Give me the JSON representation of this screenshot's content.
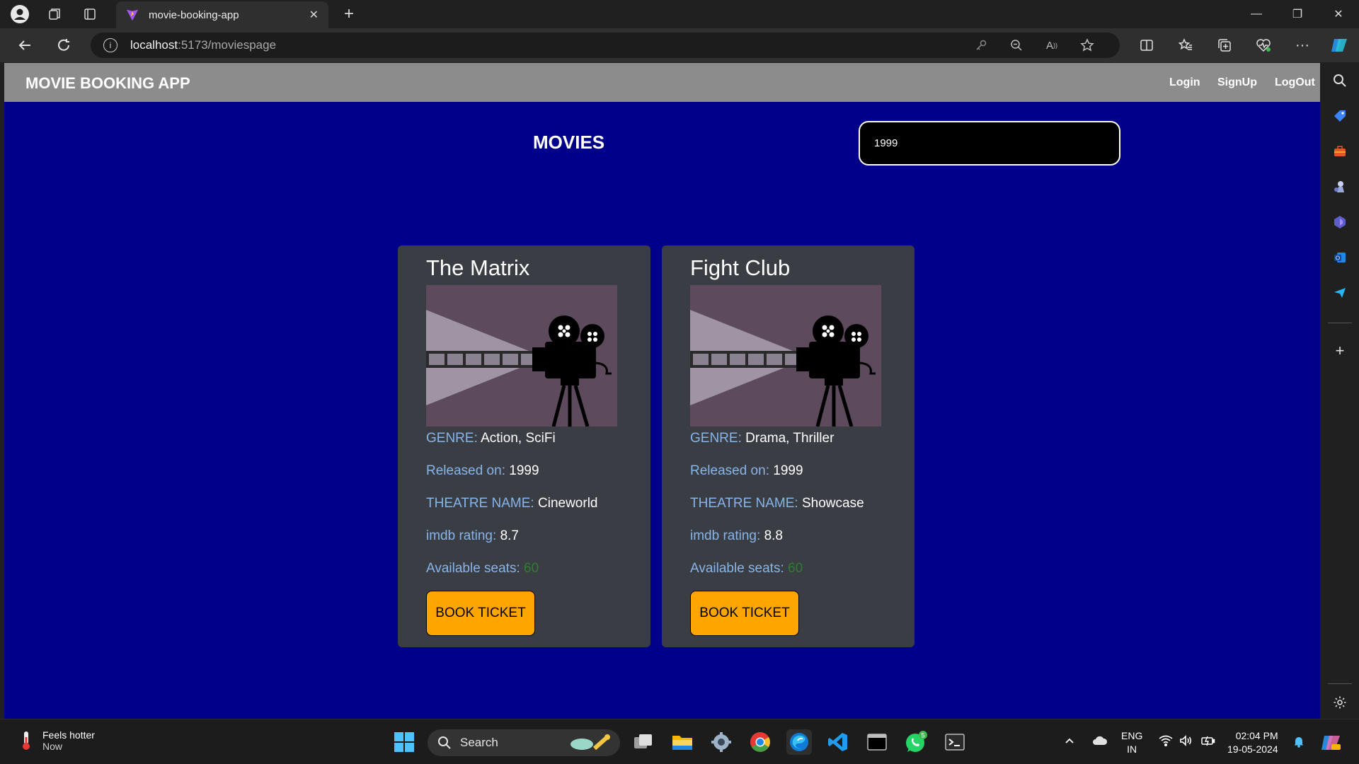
{
  "browser": {
    "tab_title": "movie-booking-app",
    "url_host": "localhost",
    "url_path": ":5173/moviespage"
  },
  "navbar": {
    "brand": "MOVIE BOOKING APP",
    "links": [
      "Login",
      "SignUp",
      "LogOut"
    ]
  },
  "main": {
    "title": "MOVIES",
    "search_value": "1999"
  },
  "labels": {
    "genre": "GENRE:",
    "released": "Released on:",
    "theatre": "THEATRE NAME:",
    "imdb": "imdb rating:",
    "seats": "Available seats:",
    "book": "BOOK TICKET"
  },
  "movies": [
    {
      "title": "The Matrix",
      "genre": "Action, SciFi",
      "released": "1999",
      "theatre": "Cineworld",
      "imdb": "8.7",
      "seats": "60"
    },
    {
      "title": "Fight Club",
      "genre": "Drama, Thriller",
      "released": "1999",
      "theatre": "Showcase",
      "imdb": "8.8",
      "seats": "60"
    }
  ],
  "taskbar": {
    "weather_title": "Feels hotter",
    "weather_sub": "Now",
    "search_label": "Search",
    "lang_1": "ENG",
    "lang_2": "IN",
    "time": "02:04 PM",
    "date": "19-05-2024",
    "whatsapp_badge": "5"
  },
  "colors": {
    "page_bg": "#00008b",
    "navbar_bg": "#8c8c8c",
    "card_bg": "#3a3d44",
    "label": "#87b5e8",
    "button": "#ffa500",
    "seats": "#2e7d32"
  }
}
